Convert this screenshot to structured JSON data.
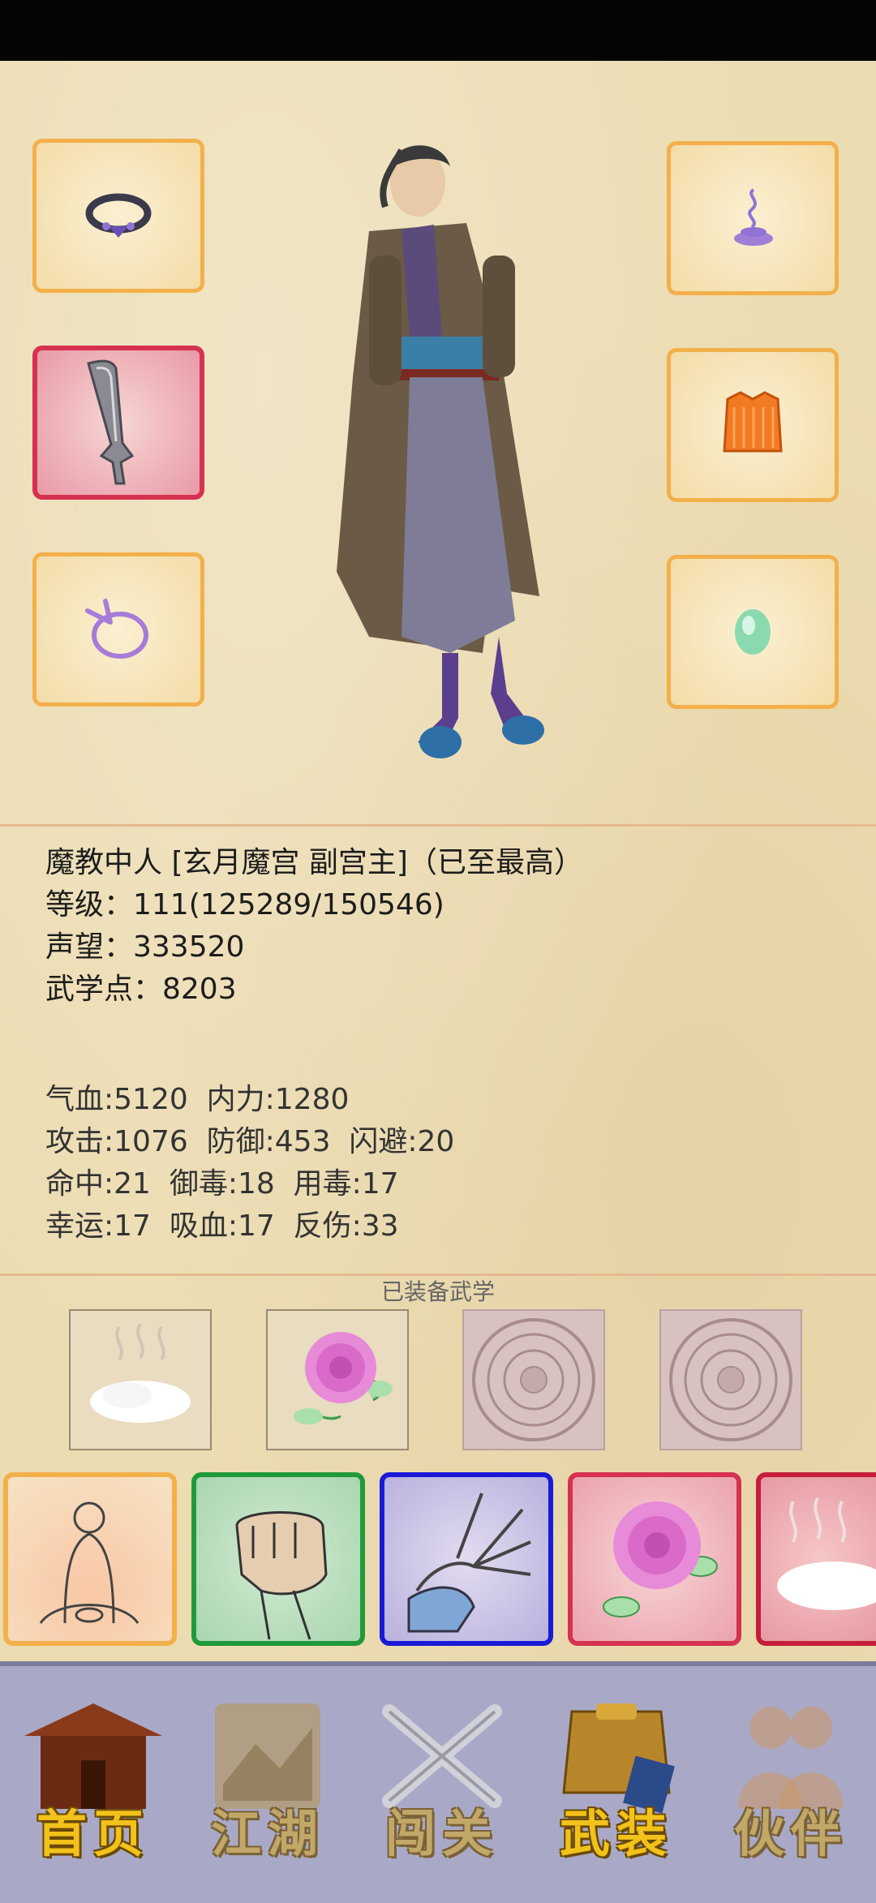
{
  "character": {
    "title": "魔教中人 [玄月魔宫 副宫主]（已至最高）",
    "level": "等级：111(125289/150546)",
    "reputation": "声望：333520",
    "martial_points": "武学点：8203"
  },
  "stats": {
    "row1": "气血:5120  内力:1280",
    "row2": "攻击:1076  防御:453  闪避:20",
    "row3": "命中:21  御毒:18  用毒:17",
    "row4": "幸运:17  吸血:17  反伤:33"
  },
  "equipped_skills_title": "已装备武学",
  "equipment_slots": [
    {
      "slot": "head",
      "icon": "ring-headband-icon"
    },
    {
      "slot": "weapon",
      "icon": "sword-icon",
      "highlight_color": "#d63150"
    },
    {
      "slot": "accessory",
      "icon": "ribbon-ring-icon"
    },
    {
      "slot": "amulet",
      "icon": "incense-smoke-icon"
    },
    {
      "slot": "armor",
      "icon": "orange-armor-icon"
    },
    {
      "slot": "gem",
      "icon": "jade-gem-icon"
    }
  ],
  "equipped_skills": [
    {
      "icon": "mist-cloud-icon"
    },
    {
      "icon": "rose-icon"
    },
    {
      "icon": "empty-seal-icon"
    },
    {
      "icon": "empty-seal-icon"
    }
  ],
  "skill_cards": [
    {
      "icon": "meditation-icon",
      "border_color": "#f3b04a"
    },
    {
      "icon": "fist-icon",
      "border_color": "#1f9a3a"
    },
    {
      "icon": "palm-icon",
      "border_color": "#1a1ad6"
    },
    {
      "icon": "rose-icon",
      "border_color": "#d63150"
    },
    {
      "icon": "mist-cloud-icon",
      "border_color": "#c41e3a"
    }
  ],
  "nav": {
    "home": "首页",
    "jianghu": "江湖",
    "challenge": "闯关",
    "equipment": "武装",
    "partner": "伙伴"
  }
}
